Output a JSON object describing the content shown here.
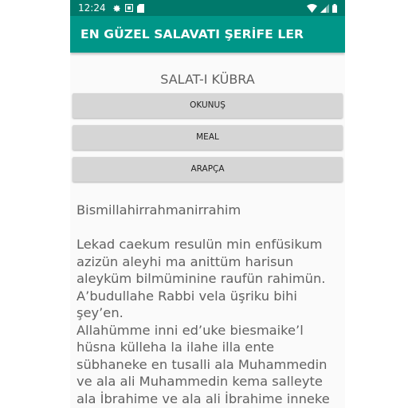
{
  "status_bar": {
    "time": "12:24",
    "icons": [
      "settings-icon",
      "notification-icon",
      "sd-card-icon",
      "wifi-icon",
      "signal-icon",
      "battery-icon"
    ]
  },
  "app_bar": {
    "title": "EN GÜZEL SALAVATI ŞERİFE LER",
    "color": "#009688",
    "status_color": "#00796b"
  },
  "section_title": "SALAT-I KÜBRA",
  "buttons": {
    "okunus": "OKUNUŞ",
    "meal": "MEAL",
    "arapca": "ARAPÇA"
  },
  "body_text": "Bismillahirrahmanirrahim\n\nLekad caekum resulün min enfüsikum azizün aleyhi ma anittüm harisun aleyküm bilmüminine raufün rahimün. A’budullahe Rabbi vela üşriku bihi şey’en.\nAllahümme inni ed’uke biesmaike’l hüsna külleha la ilahe illa ente sübhaneke en tusalli ala Muhammedin ve ala ali Muhammedin kema salleyte ala İbrahime ve ala ali İbrahime inneke hamidün mecid."
}
